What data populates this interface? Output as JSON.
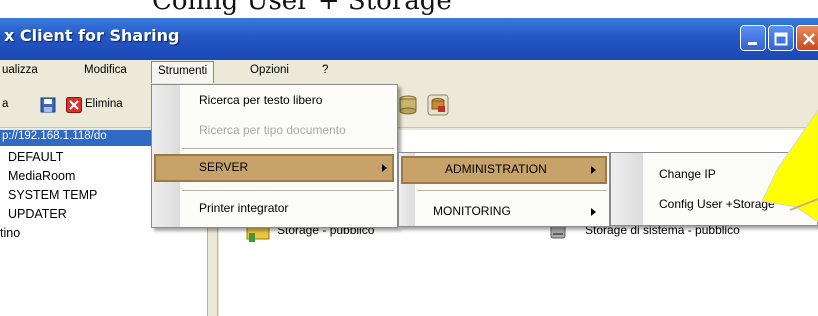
{
  "caption": "Config User + Storage",
  "window": {
    "title": "x Client for Sharing"
  },
  "menubar": {
    "items": [
      "ualizza",
      "Modifica",
      "Strumenti",
      "Opzioni",
      "?"
    ]
  },
  "toolbar": {
    "left_label": "a",
    "delete_label": "Elimina"
  },
  "left_pane": {
    "address": "p://192.168.1.118/do",
    "nodes": [
      "DEFAULT",
      "MediaRoom",
      "SYSTEM TEMP",
      "UPDATER",
      "tino"
    ]
  },
  "right_pane": {
    "items": [
      {
        "label": "Storage - pubblico"
      },
      {
        "label": "Storage di sistema - pubblico"
      }
    ]
  },
  "strumenti_menu": {
    "items": [
      "Ricerca per testo libero",
      "Ricerca per tipo documento",
      "SERVER",
      "Printer integrator"
    ]
  },
  "server_menu": {
    "items": [
      "ADMINISTRATION",
      "MONITORING"
    ]
  },
  "admin_menu": {
    "items": [
      "Change IP",
      "Config User +Storage"
    ]
  },
  "colors": {
    "title_bar": "#2457c5",
    "highlight": "#c7a36a",
    "arrow_callout": "#ffff00"
  },
  "icons": [
    "floppy-save-icon",
    "delete-x-icon",
    "db-icon",
    "folder-icon",
    "storage-drive-icon"
  ]
}
